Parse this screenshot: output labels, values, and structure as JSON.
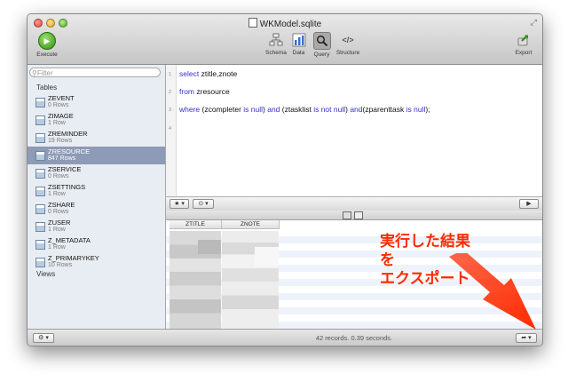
{
  "window": {
    "title": "WKModel.sqlite"
  },
  "toolbar": {
    "execute_label": "Execute",
    "schema_label": "Schema",
    "data_label": "Data",
    "query_label": "Query",
    "structure_label": "Structure",
    "export_label": "Export",
    "selected_view": "Query"
  },
  "sidebar": {
    "filter_placeholder": "Filter",
    "tables_header": "Tables",
    "views_header": "Views",
    "tables": [
      {
        "name": "ZEVENT",
        "rows": "0 Rows"
      },
      {
        "name": "ZIMAGE",
        "rows": "1 Row"
      },
      {
        "name": "ZREMINDER",
        "rows": "19 Rows"
      },
      {
        "name": "ZRESOURCE",
        "rows": "847 Rows"
      },
      {
        "name": "ZSERVICE",
        "rows": "0 Rows"
      },
      {
        "name": "ZSETTINGS",
        "rows": "1 Row"
      },
      {
        "name": "ZSHARE",
        "rows": "0 Rows"
      },
      {
        "name": "ZUSER",
        "rows": "1 Row"
      },
      {
        "name": "Z_METADATA",
        "rows": "1 Row"
      },
      {
        "name": "Z_PRIMARYKEY",
        "rows": "10 Rows"
      }
    ],
    "selected_table": "ZRESOURCE"
  },
  "editor": {
    "line_numbers": [
      "1",
      "2",
      "3",
      "4"
    ],
    "line1": {
      "kw": "select",
      "rest": " ztitle,znote"
    },
    "line2": {
      "kw": "from",
      "rest": " zresource"
    },
    "line3": {
      "kw1": "where",
      "t1": " (zcompleter ",
      "kw2": "is null",
      "t2": ") ",
      "kw3": "and",
      "t3": " (ztasklist ",
      "kw4": "is not null",
      "t4": ") ",
      "kw5": "and",
      "t5": "(zparenttask ",
      "kw6": "is null",
      "t6": ");"
    }
  },
  "results": {
    "columns": [
      "ZTITLE",
      "ZNOTE"
    ],
    "status": "42 records. 0.39 seconds."
  },
  "annotation": {
    "lines": [
      "実行した結果",
      "を",
      "エクスポート"
    ],
    "color": "#ff2a00"
  },
  "icons": {
    "star": "star-icon",
    "gear": "gear-icon",
    "play": "play-icon",
    "share": "share-arrow-icon"
  }
}
